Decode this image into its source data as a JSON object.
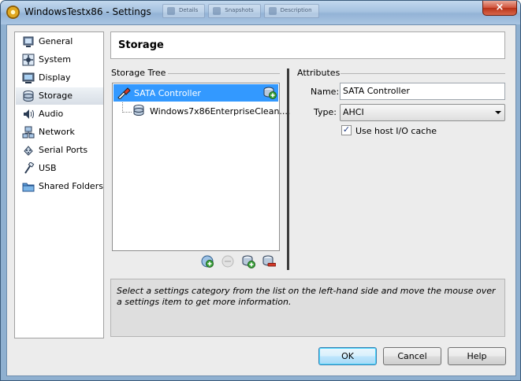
{
  "window": {
    "title": "WindowsTestx86 - Settings",
    "background_tabs": [
      "Details",
      "Snapshots",
      "Description"
    ],
    "close_symbol": "×"
  },
  "sidebar": {
    "items": [
      {
        "label": "General",
        "icon": "general-icon",
        "selected": false
      },
      {
        "label": "System",
        "icon": "system-icon",
        "selected": false
      },
      {
        "label": "Display",
        "icon": "display-icon",
        "selected": false
      },
      {
        "label": "Storage",
        "icon": "storage-icon",
        "selected": true
      },
      {
        "label": "Audio",
        "icon": "audio-icon",
        "selected": false
      },
      {
        "label": "Network",
        "icon": "network-icon",
        "selected": false
      },
      {
        "label": "Serial Ports",
        "icon": "serial-ports-icon",
        "selected": false
      },
      {
        "label": "USB",
        "icon": "usb-icon",
        "selected": false
      },
      {
        "label": "Shared Folders",
        "icon": "shared-folders-icon",
        "selected": false
      }
    ]
  },
  "page": {
    "title": "Storage"
  },
  "storage_tree": {
    "group_title": "Storage Tree",
    "controller": {
      "label": "SATA Controller",
      "icon": "sata-controller-icon",
      "action_icon": "add-hard-disk-icon"
    },
    "attachments": [
      {
        "label": "Windows7x86EnterpriseClean....",
        "icon": "hard-disk-icon"
      }
    ],
    "toolbar": [
      "add-controller-icon",
      "remove-controller-icon",
      "add-attachment-icon",
      "remove-attachment-icon"
    ]
  },
  "attributes": {
    "group_title": "Attributes",
    "name_label": "Name:",
    "name_value": "SATA Controller",
    "type_label": "Type:",
    "type_value": "AHCI",
    "host_io_cache_label": "Use host I/O cache",
    "host_io_cache_checked": true,
    "check_glyph": "✓"
  },
  "info": {
    "text": "Select a settings category from the list on the left-hand side and move the mouse over a settings item to get more information."
  },
  "buttons": {
    "ok": "OK",
    "cancel": "Cancel",
    "help": "Help"
  },
  "colors": {
    "selection": "#3399ff",
    "title_bar": "#a6c2e0",
    "close": "#c9452c"
  }
}
